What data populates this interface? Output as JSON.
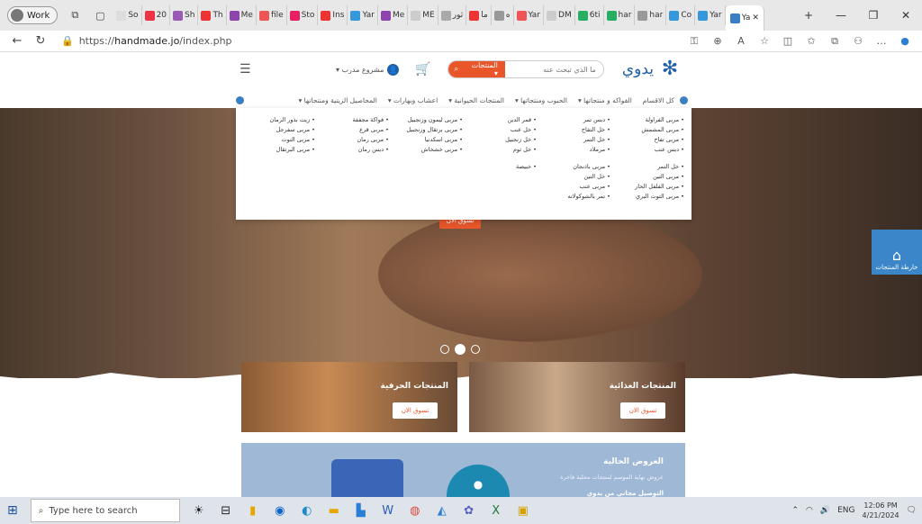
{
  "browser": {
    "profile_label": "Work",
    "tabs": [
      "So",
      "20",
      "Sh",
      "Th",
      "Me",
      "file",
      "Sto",
      "Ins",
      "Yar",
      "Me",
      "ME",
      "ثور",
      "ما",
      "ه",
      "Yar",
      "DM",
      "6ti",
      "har",
      "har",
      "Co",
      "Yar"
    ],
    "active_tab": "Ya",
    "url_prefix": "https://",
    "url_host": "handmade.jo",
    "url_path": "/index.php"
  },
  "site": {
    "logo_text": "يدوي",
    "search_placeholder": "ما الذي تبحث عنه",
    "search_category": "المنتجات ▾",
    "account_label": "مشروع مدرب ▾",
    "nav": [
      "كل الاقسام",
      "الفواكه و منتجاتها ▾",
      "الحبوب ومنتجاتها ▾",
      "المنتجات الحيوانية ▾",
      "اعشاب وبهارات ▾",
      "المحاصيل الزيتية ومنتجاتها ▾"
    ],
    "mega_cols": [
      [
        "مربى الفراولة",
        "مربى المشمش",
        "مربى تفاح",
        "دبس عنب"
      ],
      [
        "دبس تمر",
        "خل التفاح",
        "خل التمر",
        "مرملاد"
      ],
      [
        "قمر الدين",
        "خل عنب",
        "خل زنجبيل",
        "خل ثوم"
      ],
      [
        "مربى ليمون وزنجبيل",
        "مربى برتقال وزنجبيل",
        "مربى اسكدنيا",
        "مربى خشخاش"
      ],
      [
        "فواكة مجففة",
        "مربى قرع",
        "مربى رمان",
        "دبس رمان"
      ],
      [
        "زيت بذور الرمان",
        "مربى سفرجل",
        "مربى التوت",
        "مربى البرتقال"
      ]
    ],
    "mega_row2": [
      [
        "خل التمر",
        "مربى التين",
        "مربى الفلفل الحار",
        "مربى التوت البري"
      ],
      [
        "مربى باذنجان",
        "خل التين",
        "مربى عنب",
        "تمر بالشوكولاته"
      ],
      [
        "خبيصة"
      ]
    ],
    "hero_button": "تسوق الان",
    "side_button": "خارطة المنتجات",
    "cards": [
      {
        "title": "المنتجات الحرفية",
        "button": "تسوق الان"
      },
      {
        "title": "المنتجات الغذائية",
        "button": "تسوق الان"
      }
    ],
    "offers_title": "العروض الحالية",
    "offers_sub": "عروض نهاية الموسم لمنتجات محلية فاخرة",
    "offers_sub2": "التوصيل مجاني من يدوي"
  },
  "taskbar": {
    "search_placeholder": "Type here to search",
    "lang": "ENG",
    "time": "12:06 PM",
    "date": "4/21/2024"
  }
}
